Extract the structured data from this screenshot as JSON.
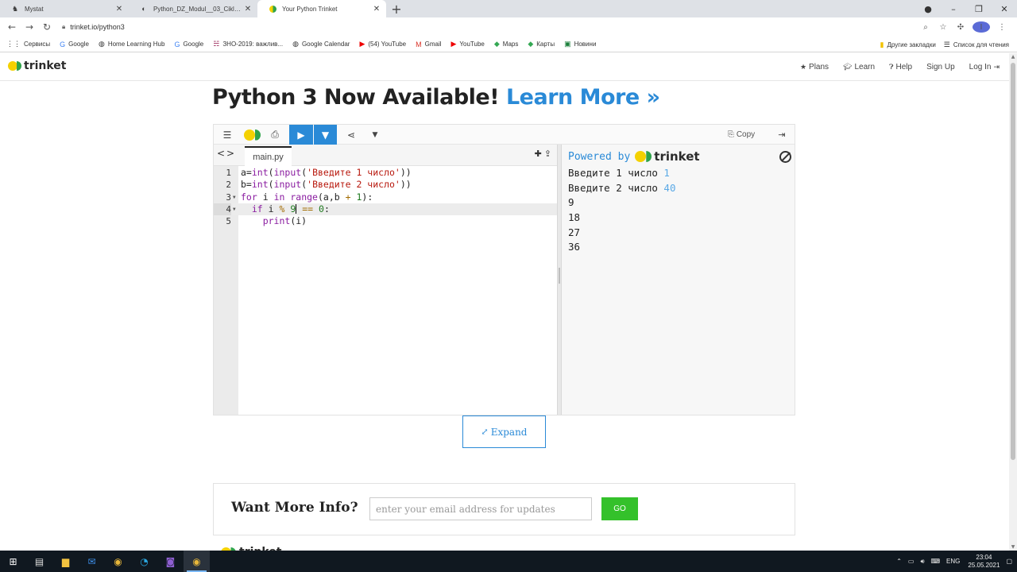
{
  "browser": {
    "tabs": [
      {
        "title": "Mystat",
        "icon": "mystat-icon",
        "active": false
      },
      {
        "title": "Python_DZ_Modul__03_Cikly_c_2",
        "icon": "google-docs-icon",
        "active": false
      },
      {
        "title": "Your Python Trinket",
        "icon": "trinket-icon",
        "active": true
      }
    ],
    "url": "trinket.io/python3",
    "bookmarks": [
      {
        "label": "Сервисы",
        "icon": "apps-icon"
      },
      {
        "label": "Google",
        "icon": "google-icon"
      },
      {
        "label": "Home Learning Hub",
        "icon": "globe-icon"
      },
      {
        "label": "Google",
        "icon": "google-icon"
      },
      {
        "label": "ЗНО-2019: важлив...",
        "icon": "zno-icon"
      },
      {
        "label": "Google Calendar",
        "icon": "globe-icon"
      },
      {
        "label": "(54) YouTube",
        "icon": "youtube-icon"
      },
      {
        "label": "Gmail",
        "icon": "gmail-icon"
      },
      {
        "label": "YouTube",
        "icon": "youtube-icon"
      },
      {
        "label": "Maps",
        "icon": "maps-icon"
      },
      {
        "label": "Карты",
        "icon": "maps-icon"
      },
      {
        "label": "Новини",
        "icon": "news-icon"
      }
    ],
    "bookmarks_right": [
      {
        "label": "Другие закладки",
        "icon": "folder-icon"
      },
      {
        "label": "Список для чтения",
        "icon": "reading-list-icon"
      }
    ],
    "avatar_letter": "I"
  },
  "site": {
    "logo_text": "trinket",
    "nav": [
      {
        "label": "Plans",
        "icon": "star-icon"
      },
      {
        "label": "Learn",
        "icon": "graduation-cap-icon"
      },
      {
        "label": "Help",
        "icon": "question-circle-icon"
      },
      {
        "label": "Sign Up",
        "icon": ""
      },
      {
        "label": "Log In",
        "icon": "sign-in-icon"
      }
    ],
    "headline": "Python 3 Now Available!",
    "headline_link": "Learn More »"
  },
  "editor": {
    "copy_label": "Copy",
    "file_tab": "main.py",
    "active_line": 4
  },
  "output": {
    "powered_by": "Powered by",
    "brand": "trinket",
    "lines": [
      {
        "text": "Введите 1 число ",
        "input": "1"
      },
      {
        "text": "Введите 2 число ",
        "input": "40"
      },
      {
        "text": "9",
        "input": ""
      },
      {
        "text": "18",
        "input": ""
      },
      {
        "text": "27",
        "input": ""
      },
      {
        "text": "36",
        "input": ""
      }
    ]
  },
  "expand_label": "Expand",
  "info": {
    "title": "Want More Info?",
    "placeholder": "enter your email address for updates",
    "go_label": "GO"
  },
  "footer_peek": "trinket",
  "taskbar": {
    "lang": "ENG",
    "time": "23:04",
    "date": "25.05.2021"
  }
}
